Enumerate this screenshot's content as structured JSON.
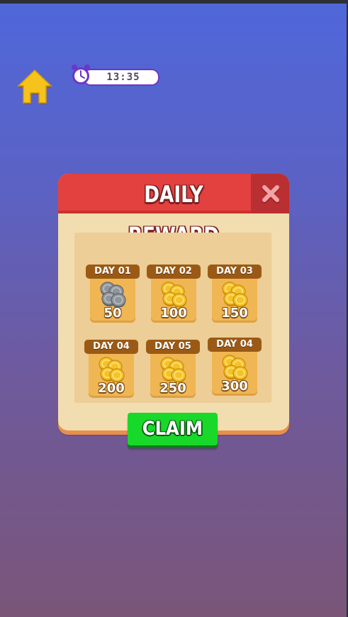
{
  "header": {
    "home_icon": "home-icon",
    "home_color": "#f6c21c"
  },
  "panel": {
    "title": "DAILY REWARD",
    "close_icon": "close-icon",
    "header_color": "#e2413f",
    "body_color": "#f2ddb0"
  },
  "timer": {
    "icon": "alarm-clock-icon",
    "value": "13:35",
    "accent": "#6e35c9"
  },
  "days": [
    {
      "label": "DAY 01",
      "amount": "50",
      "coin": "silver"
    },
    {
      "label": "DAY 02",
      "amount": "100",
      "coin": "gold"
    },
    {
      "label": "DAY 03",
      "amount": "150",
      "coin": "gold"
    },
    {
      "label": "DAY 04",
      "amount": "200",
      "coin": "gold"
    },
    {
      "label": "DAY 05",
      "amount": "250",
      "coin": "gold"
    },
    {
      "label": "DAY 04",
      "amount": "300",
      "coin": "gold"
    }
  ],
  "claim": {
    "label": "CLAIM",
    "color": "#18d92a"
  }
}
